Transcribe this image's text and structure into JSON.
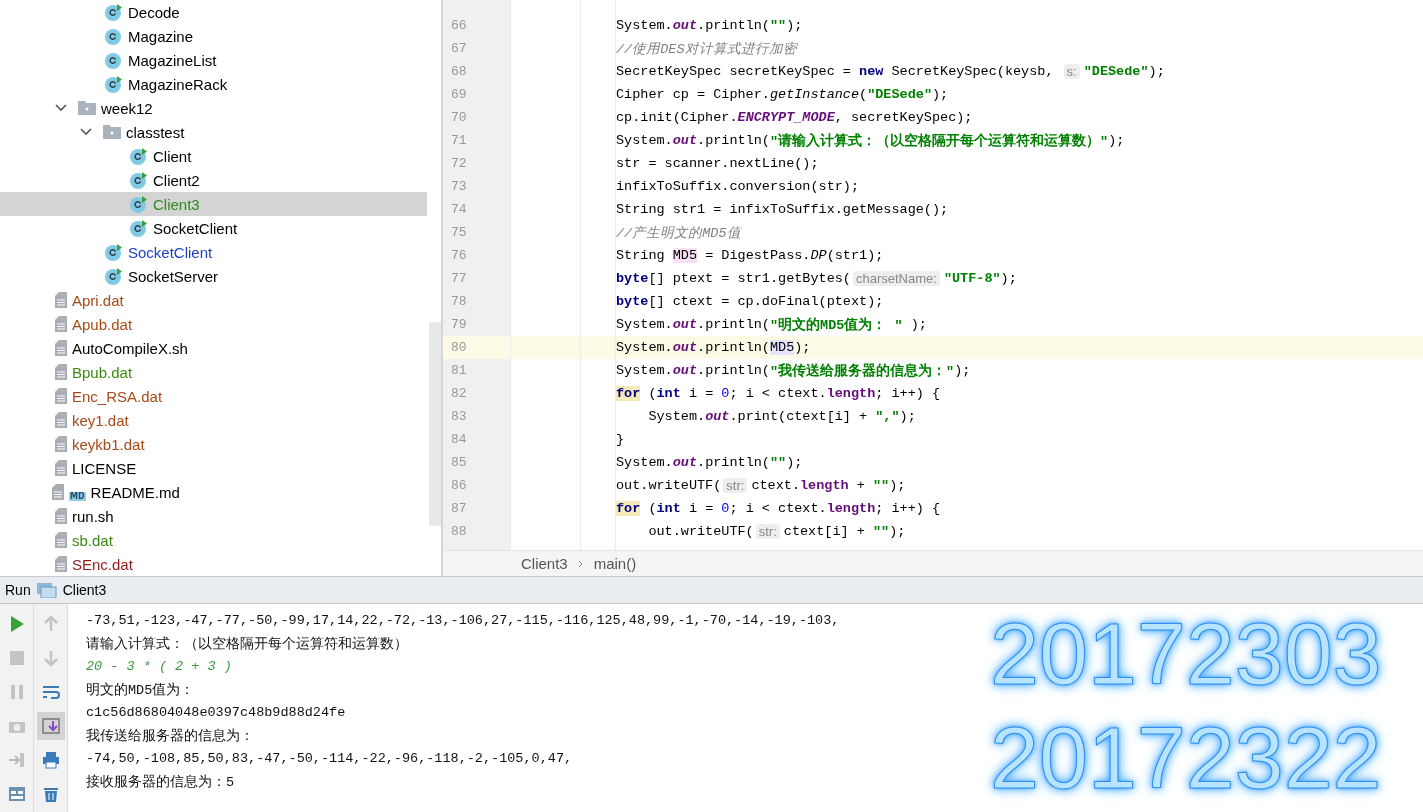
{
  "project_tree": {
    "items": [
      {
        "name": "Decode",
        "kind": "class",
        "runnable": true,
        "color": "#000000",
        "selected": false
      },
      {
        "name": "Magazine",
        "kind": "class",
        "runnable": false,
        "color": "#000000",
        "selected": false
      },
      {
        "name": "MagazineList",
        "kind": "class",
        "runnable": false,
        "color": "#000000",
        "selected": false
      },
      {
        "name": "MagazineRack",
        "kind": "class",
        "runnable": true,
        "color": "#000000",
        "selected": false
      },
      {
        "name": "week12",
        "kind": "folder",
        "expanded": true,
        "color": "#000000",
        "selected": false,
        "children": [
          {
            "name": "classtest",
            "kind": "folder",
            "expanded": true,
            "color": "#000000",
            "selected": false,
            "children": [
              {
                "name": "Client",
                "kind": "class",
                "runnable": true,
                "color": "#000000",
                "selected": false
              },
              {
                "name": "Client2",
                "kind": "class",
                "runnable": true,
                "color": "#000000",
                "selected": false
              },
              {
                "name": "Client3",
                "kind": "class",
                "runnable": true,
                "color": "#2e8b1f",
                "selected": true
              },
              {
                "name": "SocketClient",
                "kind": "class",
                "runnable": true,
                "color": "#000000",
                "selected": false
              }
            ]
          },
          {
            "name": "SocketClient",
            "kind": "class",
            "runnable": true,
            "color": "#1f3fbf",
            "selected": false
          },
          {
            "name": "SocketServer",
            "kind": "class",
            "runnable": true,
            "color": "#000000",
            "selected": false
          }
        ]
      },
      {
        "name": "Apri.dat",
        "kind": "file",
        "color": "#a84a16",
        "selected": false
      },
      {
        "name": "Apub.dat",
        "kind": "file",
        "color": "#a84a16",
        "selected": false
      },
      {
        "name": "AutoCompileX.sh",
        "kind": "file",
        "color": "#000000",
        "selected": false
      },
      {
        "name": "Bpub.dat",
        "kind": "file",
        "color": "#3d8a12",
        "selected": false
      },
      {
        "name": "Enc_RSA.dat",
        "kind": "file",
        "color": "#a84a16",
        "selected": false
      },
      {
        "name": "key1.dat",
        "kind": "file",
        "color": "#a84a16",
        "selected": false
      },
      {
        "name": "keykb1.dat",
        "kind": "file",
        "color": "#a84a16",
        "selected": false
      },
      {
        "name": "LICENSE",
        "kind": "file",
        "color": "#000000",
        "selected": false
      },
      {
        "name": "README.md",
        "kind": "markdown",
        "badge": "MD",
        "color": "#000000",
        "selected": false
      },
      {
        "name": "run.sh",
        "kind": "file",
        "color": "#000000",
        "selected": false
      },
      {
        "name": "sb.dat",
        "kind": "file",
        "color": "#3d8a12",
        "selected": false
      },
      {
        "name": "SEnc.dat",
        "kind": "file",
        "color": "#8f1d1d",
        "selected": false
      }
    ]
  },
  "editor": {
    "lines": [
      {
        "number": "66",
        "current": false,
        "tokens": [
          {
            "t": "System.",
            "kind": "p"
          },
          {
            "t": "out",
            "kind": "f"
          },
          {
            "t": ".println(",
            "kind": "p"
          },
          {
            "t": "\"\"",
            "kind": "s"
          },
          {
            "t": ");",
            "kind": "p"
          }
        ]
      },
      {
        "number": "67",
        "current": false,
        "tokens": [
          {
            "t": "//使用DES对计算式进行加密",
            "kind": "c"
          }
        ]
      },
      {
        "number": "68",
        "current": false,
        "tokens": [
          {
            "t": "SecretKeySpec secretKeySpec = ",
            "kind": "p"
          },
          {
            "t": "new",
            "kind": "k"
          },
          {
            "t": " SecretKeySpec(keysb, ",
            "kind": "p"
          },
          {
            "t": "s:",
            "kind": "h"
          },
          {
            "t": "\"DESede\"",
            "kind": "s"
          },
          {
            "t": ");",
            "kind": "p"
          }
        ]
      },
      {
        "number": "69",
        "current": false,
        "tokens": [
          {
            "t": "Cipher cp = Cipher.",
            "kind": "p"
          },
          {
            "t": "getInstance",
            "kind": "i"
          },
          {
            "t": "(",
            "kind": "p"
          },
          {
            "t": "\"DESede\"",
            "kind": "s"
          },
          {
            "t": ");",
            "kind": "p"
          }
        ]
      },
      {
        "number": "70",
        "current": false,
        "tokens": [
          {
            "t": "cp.init(Cipher.",
            "kind": "p"
          },
          {
            "t": "ENCRYPT_MODE",
            "kind": "f"
          },
          {
            "t": ", secretKeySpec);",
            "kind": "p"
          }
        ]
      },
      {
        "number": "71",
        "current": false,
        "tokens": [
          {
            "t": "System.",
            "kind": "p"
          },
          {
            "t": "out",
            "kind": "f"
          },
          {
            "t": ".println(",
            "kind": "p"
          },
          {
            "t": "\"请输入计算式：（以空格隔开每个运算符和运算数）\"",
            "kind": "s"
          },
          {
            "t": ");",
            "kind": "p"
          }
        ]
      },
      {
        "number": "72",
        "current": false,
        "tokens": [
          {
            "t": "str = scanner.nextLine();",
            "kind": "p"
          }
        ]
      },
      {
        "number": "73",
        "current": false,
        "tokens": [
          {
            "t": "infixToSuffix.conversion(str);",
            "kind": "p"
          }
        ]
      },
      {
        "number": "74",
        "current": false,
        "tokens": [
          {
            "t": "String str1 = infixToSuffix.getMessage();",
            "kind": "p"
          }
        ]
      },
      {
        "number": "75",
        "current": false,
        "tokens": [
          {
            "t": "//产生明文的MD5值",
            "kind": "c"
          }
        ]
      },
      {
        "number": "76",
        "current": false,
        "tokens": [
          {
            "t": "String ",
            "kind": "p"
          },
          {
            "t": "MD5",
            "kind": "d"
          },
          {
            "t": " = DigestPass.",
            "kind": "p"
          },
          {
            "t": "DP",
            "kind": "i"
          },
          {
            "t": "(str1);",
            "kind": "p"
          }
        ]
      },
      {
        "number": "77",
        "current": false,
        "tokens": [
          {
            "t": "byte",
            "kind": "k"
          },
          {
            "t": "[] ptext = str1.getBytes(",
            "kind": "p"
          },
          {
            "t": "charsetName:",
            "kind": "h"
          },
          {
            "t": "\"UTF-8\"",
            "kind": "s"
          },
          {
            "t": ");",
            "kind": "p"
          }
        ]
      },
      {
        "number": "78",
        "current": false,
        "tokens": [
          {
            "t": "byte",
            "kind": "k"
          },
          {
            "t": "[] ctext = cp.doFinal(ptext);",
            "kind": "p"
          }
        ]
      },
      {
        "number": "79",
        "current": false,
        "tokens": [
          {
            "t": "System.",
            "kind": "p"
          },
          {
            "t": "out",
            "kind": "f"
          },
          {
            "t": ".println(",
            "kind": "p"
          },
          {
            "t": "\"明文的MD5值为： \"",
            "kind": "s"
          },
          {
            "t": " );",
            "kind": "p"
          }
        ]
      },
      {
        "number": "80",
        "current": true,
        "tokens": [
          {
            "t": "System.",
            "kind": "p"
          },
          {
            "t": "out",
            "kind": "f"
          },
          {
            "t": ".println(",
            "kind": "p"
          },
          {
            "t": "MD5",
            "kind": "u"
          },
          {
            "t": ");",
            "kind": "p"
          }
        ]
      },
      {
        "number": "81",
        "current": false,
        "tokens": [
          {
            "t": "System.",
            "kind": "p"
          },
          {
            "t": "out",
            "kind": "f"
          },
          {
            "t": ".println(",
            "kind": "p"
          },
          {
            "t": "\"我传送给服务器的信息为：\"",
            "kind": "s"
          },
          {
            "t": ");",
            "kind": "p"
          }
        ]
      },
      {
        "number": "82",
        "current": false,
        "tokens": [
          {
            "t": "for",
            "kind": "m"
          },
          {
            "t": " (",
            "kind": "p"
          },
          {
            "t": "int",
            "kind": "k"
          },
          {
            "t": " i = ",
            "kind": "p"
          },
          {
            "t": "0",
            "kind": "n"
          },
          {
            "t": "; i < ctext.",
            "kind": "p"
          },
          {
            "t": "length",
            "kind": "l"
          },
          {
            "t": "; i++) {",
            "kind": "p"
          }
        ]
      },
      {
        "number": "83",
        "current": false,
        "tokens": [
          {
            "t": "    System.",
            "kind": "p"
          },
          {
            "t": "out",
            "kind": "f"
          },
          {
            "t": ".print(ctext[i] + ",
            "kind": "p"
          },
          {
            "t": "\",\"",
            "kind": "s"
          },
          {
            "t": ");",
            "kind": "p"
          }
        ]
      },
      {
        "number": "84",
        "current": false,
        "tokens": [
          {
            "t": "}",
            "kind": "p"
          }
        ]
      },
      {
        "number": "85",
        "current": false,
        "tokens": [
          {
            "t": "System.",
            "kind": "p"
          },
          {
            "t": "out",
            "kind": "f"
          },
          {
            "t": ".println(",
            "kind": "p"
          },
          {
            "t": "\"\"",
            "kind": "s"
          },
          {
            "t": ");",
            "kind": "p"
          }
        ]
      },
      {
        "number": "86",
        "current": false,
        "tokens": [
          {
            "t": "out.writeUTF(",
            "kind": "p"
          },
          {
            "t": "str:",
            "kind": "h"
          },
          {
            "t": "ctext.",
            "kind": "p"
          },
          {
            "t": "length",
            "kind": "l"
          },
          {
            "t": " + ",
            "kind": "p"
          },
          {
            "t": "\"\"",
            "kind": "s"
          },
          {
            "t": ");",
            "kind": "p"
          }
        ]
      },
      {
        "number": "87",
        "current": false,
        "tokens": [
          {
            "t": "for",
            "kind": "m"
          },
          {
            "t": " (",
            "kind": "p"
          },
          {
            "t": "int",
            "kind": "k"
          },
          {
            "t": " i = ",
            "kind": "p"
          },
          {
            "t": "0",
            "kind": "n"
          },
          {
            "t": "; i < ctext.",
            "kind": "p"
          },
          {
            "t": "length",
            "kind": "l"
          },
          {
            "t": "; i++) {",
            "kind": "p"
          }
        ]
      },
      {
        "number": "88",
        "current": false,
        "tokens": [
          {
            "t": "    out.writeUTF(",
            "kind": "p"
          },
          {
            "t": "str:",
            "kind": "h"
          },
          {
            "t": "ctext[i] + ",
            "kind": "p"
          },
          {
            "t": "\"\"",
            "kind": "s"
          },
          {
            "t": ");",
            "kind": "p"
          }
        ]
      }
    ],
    "breadcrumb": [
      "Client3",
      "main()"
    ]
  },
  "run_panel": {
    "title": "Run",
    "config": "Client3",
    "console": [
      {
        "text": "-73,51,-123,-47,-77,-50,-99,17,14,22,-72,-13,-106,27,-115,-116,125,48,99,-1,-70,-14,-19,-103,",
        "kind": "output"
      },
      {
        "text": "请输入计算式：（以空格隔开每个运算符和运算数）",
        "kind": "output"
      },
      {
        "text": "20 - 3 * ( 2 + 3 )",
        "kind": "input"
      },
      {
        "text": "明文的MD5值为：",
        "kind": "output"
      },
      {
        "text": "c1c56d86804048e0397c48b9d88d24fe",
        "kind": "output"
      },
      {
        "text": "我传送给服务器的信息为：",
        "kind": "output"
      },
      {
        "text": "-74,50,-108,85,50,83,-47,-50,-114,-22,-96,-118,-2,-105,0,47,",
        "kind": "output"
      },
      {
        "text": "接收服务器的信息为：5",
        "kind": "output"
      }
    ]
  },
  "overlay_numbers": [
    "20172303",
    "20172322"
  ]
}
